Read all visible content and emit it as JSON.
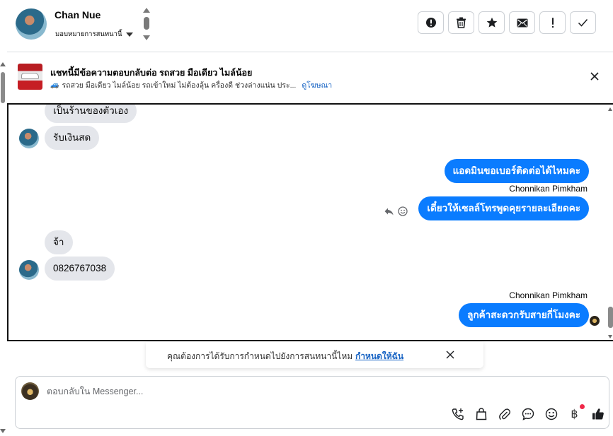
{
  "header": {
    "contact_name": "Chan Nue",
    "assign_label": "มอบหมายการสนทนานี้",
    "toolbar": [
      {
        "icon": "alert-circle-icon",
        "name": "mark-spam-button"
      },
      {
        "icon": "trash-icon",
        "name": "delete-button"
      },
      {
        "icon": "star-icon",
        "name": "star-button"
      },
      {
        "icon": "envelope-icon",
        "name": "mark-unread-button"
      },
      {
        "icon": "exclamation-icon",
        "name": "follow-up-button"
      },
      {
        "icon": "check-icon",
        "name": "mark-done-button"
      }
    ]
  },
  "ad": {
    "title": "แชทนี้มีข้อความตอบกลับต่อ รถสวย มือเดียว ไมล์น้อย",
    "subtitle": "รถสวย มือเดียว ไมล์น้อย รถเข้าใหม่ ไม่ต้องลุ้น ครื่องดี ช่วงล่างแน่น ประ...",
    "link": "ดูโฆษณา"
  },
  "messages": [
    {
      "dir": "in",
      "text": "เป็นร้านของตัวเอง"
    },
    {
      "dir": "in",
      "text": "รับเงินสด"
    },
    {
      "dir": "out",
      "text": "แอดมินขอเบอร์ติดต่อได้ไหมคะ"
    },
    {
      "dir": "out",
      "sender": "Chonnikan Pimkham",
      "text": "เดี๋ยวให้เซลล์โทรพูดคุยรายละเอียดคะ"
    },
    {
      "dir": "in",
      "text": "จ้า"
    },
    {
      "dir": "in",
      "text": "0826767038"
    },
    {
      "dir": "out",
      "sender": "Chonnikan Pimkham",
      "text": "ลูกค้าสะดวกรับสายกี่โมงคะ"
    }
  ],
  "reminder": {
    "text": "คุณต้องการได้รับการกำหนดไปยังการสนทนานี้ไหม",
    "link": "กำหนดให้ฉัน"
  },
  "composer": {
    "placeholder": "ตอบกลับใน Messenger...",
    "tools": [
      "call-add-icon",
      "shopping-bag-icon",
      "paperclip-icon",
      "saved-reply-icon",
      "emoji-icon",
      "baht-payment-icon",
      "thumbs-up-icon"
    ],
    "baht_symbol": "฿"
  },
  "colors": {
    "accent": "#0a7cff",
    "incoming_bubble": "#e4e6eb",
    "link": "#1864c4",
    "notification_dot": "#f02849"
  }
}
